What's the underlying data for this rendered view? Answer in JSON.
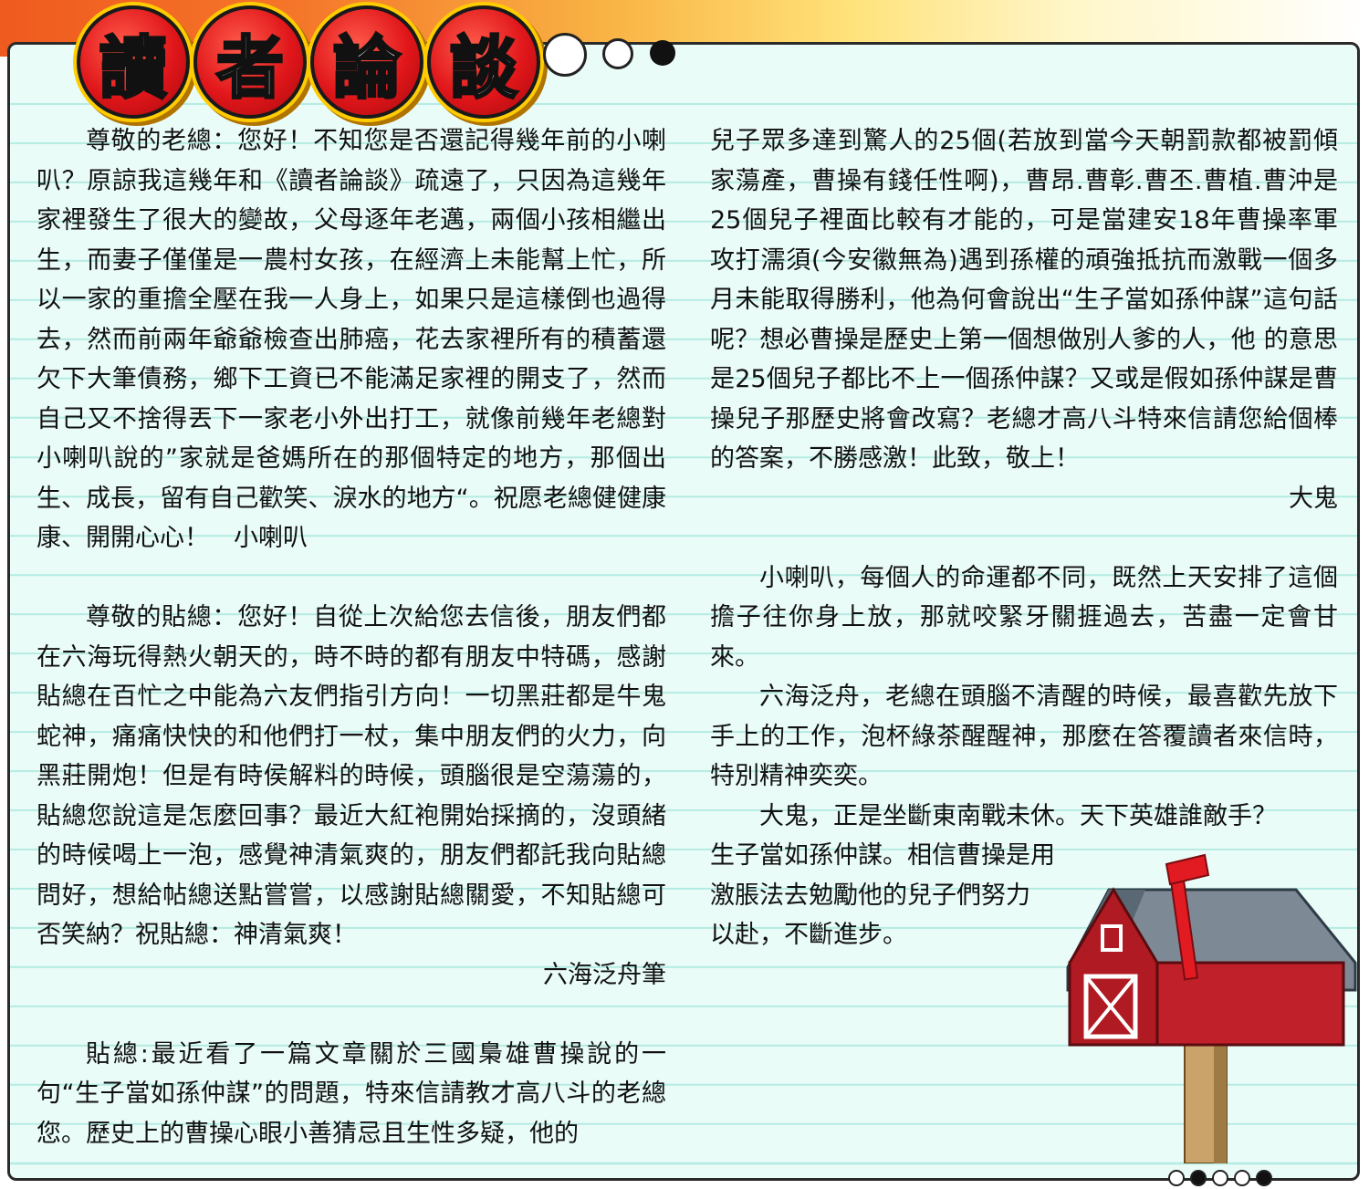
{
  "title": {
    "chars": [
      "讀",
      "者",
      "論",
      "談"
    ]
  },
  "colors": {
    "header_orange": "#ef5a1e",
    "badge_red": "#e0161a",
    "card_bg": "#eafcf8",
    "rule_line": "#b4ebe2"
  },
  "left": {
    "letter1": "尊敬的老總：您好！不知您是否還記得幾年前的小喇叭？原諒我這幾年和《讀者論談》疏遠了，只因為這幾年家裡發生了很大的變故，父母逐年老邁，兩個小孩相繼出生，而妻子僅僅是一農村女孩，在經濟上未能幫上忙，所以一家的重擔全壓在我一人身上，如果只是這樣倒也過得去，然而前兩年爺爺檢查出肺癌，花去家裡所有的積蓄還欠下大筆債務，鄉下工資已不能滿足家裡的開支了，然而自己又不捨得丟下一家老小外出打工，就像前幾年老總對小喇叭說的”家就是爸媽所在的那個特定的地方，那個出生、成長，留有自己歡笑、淚水的地方“。祝愿老總健健康康、開開心心！　小喇叭",
    "letter2": "尊敬的貼總：您好！自從上次給您去信後，朋友們都在六海玩得熱火朝天的，時不時的都有朋友中特碼，感謝貼總在百忙之中能為六友們指引方向！一切黑莊都是牛鬼蛇神，痛痛快快的和他們打一杖，集中朋友們的火力，向黑莊開炮！但是有時侯解料的時候，頭腦很是空蕩蕩的，貼總您說這是怎麼回事？最近大紅袍開始採摘的，沒頭緒的時候喝上一泡，感覺神清氣爽的，朋友們都託我向貼總問好，想給帖總送點嘗嘗，以感謝貼總關愛，不知貼總可否笑納？祝貼總：神清氣爽！",
    "letter2_sign": "六海泛舟筆",
    "letter3_start": "貼總:最近看了一篇文章關於三國梟雄曹操說的一句“生子當如孫仲謀”的問題，特來信請教才高八斗的老總您。歷史上的曹操心眼小善猜忌且生性多疑，他的"
  },
  "right": {
    "letter3_cont": "兒子眾多達到驚人的25個(若放到當今天朝罰款都被罰傾家蕩產，曹操有錢任性啊)，曹昂.曹彰.曹丕.曹植.曹沖是25個兒子裡面比較有才能的，可是當建安18年曹操率軍攻打濡須(今安徽無為)遇到孫權的頑強抵抗而激戰一個多月未能取得勝利，他為何會說出“生子當如孫仲謀”這句話呢？想必曹操是歷史上第一個想做別人爹的人，他 的意思是25個兒子都比不上一個孫仲謀？又或是假如孫仲謀是曹操兒子那歷史將會改寫？老總才高八斗特來信請您給個棒的答案，不勝感激！此致，敬上！",
    "letter3_sign": "大鬼",
    "reply1": "小喇叭，每個人的命運都不同，既然上天安排了這個擔子往你身上放，那就咬緊牙關捱過去，苦盡一定會甘來。",
    "reply2": "六海泛舟，老總在頭腦不清醒的時候，最喜歡先放下手上的工作，泡杯綠茶醒醒神，那麼在答覆讀者來信時，特別精神奕奕。",
    "reply3a": "大鬼，正是坐斷東南戰未休。天下英雄誰敵手？",
    "reply3b": "生子當如孫仲謀。相信曹操是用",
    "reply3c": "激脹法去勉勵他的兒子們努力",
    "reply3d": "以赴，不斷進步。"
  }
}
